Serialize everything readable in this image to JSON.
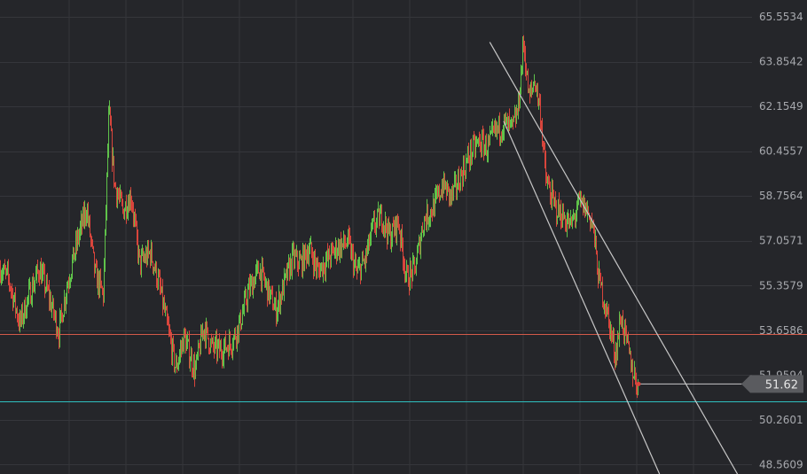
{
  "chart_data": {
    "type": "candlestick",
    "colors": {
      "background": "#25262a",
      "grid": "#35363b",
      "up": "#5fc24a",
      "down": "#d8453c",
      "resistance": "#d35a49",
      "support": "#2fc0c0",
      "trendline": "#c7c7c7",
      "price_tag": "#5a5b5f"
    },
    "y_axis": {
      "ylim": [
        48.2,
        66.2
      ],
      "ticks": [
        "65.5534",
        "63.8542",
        "62.1549",
        "60.4557",
        "58.7564",
        "57.0571",
        "55.3579",
        "53.6586",
        "51.9594",
        "50.2601",
        "48.5609"
      ]
    },
    "x_range": [
      0,
      290
    ],
    "current_price": "51.62",
    "horizontal_levels": [
      {
        "kind": "resistance",
        "value": 53.52
      },
      {
        "kind": "support",
        "value": 50.95
      }
    ],
    "trendlines": [
      {
        "x1": 176,
        "y1": 64.6,
        "x2": 265,
        "y2": 48.2
      },
      {
        "x1": 181,
        "y1": 61.6,
        "x2": 237,
        "y2": 48.2
      }
    ],
    "price_path": [
      {
        "x": 0,
        "y": 56.0
      },
      {
        "x": 3,
        "y": 55.6
      },
      {
        "x": 7,
        "y": 53.9
      },
      {
        "x": 10,
        "y": 54.9
      },
      {
        "x": 14,
        "y": 56.0
      },
      {
        "x": 17,
        "y": 55.1
      },
      {
        "x": 21,
        "y": 53.6
      },
      {
        "x": 24,
        "y": 55.4
      },
      {
        "x": 28,
        "y": 57.2
      },
      {
        "x": 31,
        "y": 58.3
      },
      {
        "x": 34,
        "y": 55.8
      },
      {
        "x": 37,
        "y": 55.0
      },
      {
        "x": 39,
        "y": 62.0
      },
      {
        "x": 41,
        "y": 59.2
      },
      {
        "x": 44,
        "y": 58.2
      },
      {
        "x": 47,
        "y": 58.8
      },
      {
        "x": 50,
        "y": 56.2
      },
      {
        "x": 54,
        "y": 56.6
      },
      {
        "x": 57,
        "y": 55.4
      },
      {
        "x": 60,
        "y": 53.8
      },
      {
        "x": 63,
        "y": 52.2
      },
      {
        "x": 66,
        "y": 53.4
      },
      {
        "x": 70,
        "y": 52.1
      },
      {
        "x": 73,
        "y": 53.8
      },
      {
        "x": 76,
        "y": 53.0
      },
      {
        "x": 79,
        "y": 52.9
      },
      {
        "x": 83,
        "y": 53.2
      },
      {
        "x": 86,
        "y": 53.9
      },
      {
        "x": 89,
        "y": 55.1
      },
      {
        "x": 93,
        "y": 56.0
      },
      {
        "x": 96,
        "y": 55.2
      },
      {
        "x": 99,
        "y": 54.4
      },
      {
        "x": 102,
        "y": 55.4
      },
      {
        "x": 105,
        "y": 56.4
      },
      {
        "x": 108,
        "y": 56.2
      },
      {
        "x": 111,
        "y": 56.8
      },
      {
        "x": 114,
        "y": 55.9
      },
      {
        "x": 118,
        "y": 56.4
      },
      {
        "x": 121,
        "y": 56.8
      },
      {
        "x": 125,
        "y": 57.0
      },
      {
        "x": 128,
        "y": 55.8
      },
      {
        "x": 131,
        "y": 56.3
      },
      {
        "x": 134,
        "y": 57.6
      },
      {
        "x": 137,
        "y": 58.0
      },
      {
        "x": 140,
        "y": 57.2
      },
      {
        "x": 143,
        "y": 57.8
      },
      {
        "x": 146,
        "y": 55.6
      },
      {
        "x": 149,
        "y": 56.0
      },
      {
        "x": 152,
        "y": 57.8
      },
      {
        "x": 156,
        "y": 58.4
      },
      {
        "x": 159,
        "y": 59.2
      },
      {
        "x": 162,
        "y": 58.7
      },
      {
        "x": 165,
        "y": 59.4
      },
      {
        "x": 169,
        "y": 60.4
      },
      {
        "x": 172,
        "y": 60.8
      },
      {
        "x": 175,
        "y": 60.6
      },
      {
        "x": 178,
        "y": 61.2
      },
      {
        "x": 181,
        "y": 61.5
      },
      {
        "x": 184,
        "y": 61.3
      },
      {
        "x": 186,
        "y": 62.0
      },
      {
        "x": 188,
        "y": 64.6
      },
      {
        "x": 190,
        "y": 62.4
      },
      {
        "x": 192,
        "y": 63.2
      },
      {
        "x": 194,
        "y": 62.0
      },
      {
        "x": 196,
        "y": 59.4
      },
      {
        "x": 199,
        "y": 58.4
      },
      {
        "x": 202,
        "y": 58.0
      },
      {
        "x": 205,
        "y": 57.6
      },
      {
        "x": 208,
        "y": 58.5
      },
      {
        "x": 211,
        "y": 58.2
      },
      {
        "x": 213,
        "y": 57.6
      },
      {
        "x": 215,
        "y": 55.6
      },
      {
        "x": 217,
        "y": 54.8
      },
      {
        "x": 219,
        "y": 53.8
      },
      {
        "x": 221,
        "y": 52.7
      },
      {
        "x": 223,
        "y": 54.2
      },
      {
        "x": 225,
        "y": 53.2
      },
      {
        "x": 227,
        "y": 52.2
      },
      {
        "x": 229,
        "y": 51.6
      }
    ]
  }
}
